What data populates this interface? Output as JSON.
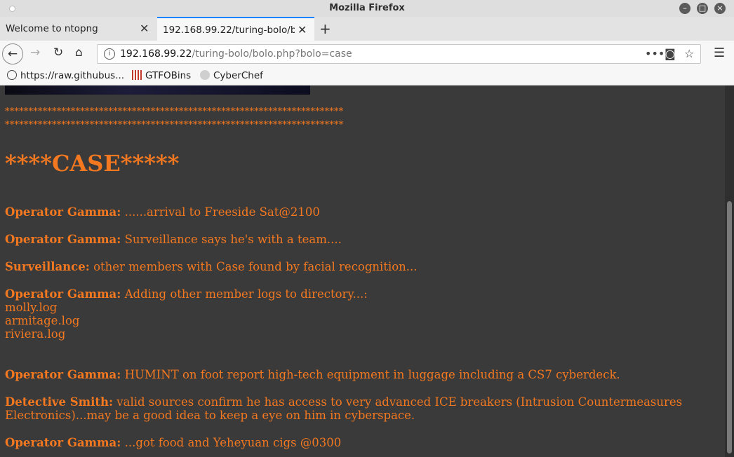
{
  "window": {
    "title": "Mozilla Firefox"
  },
  "tabs": [
    {
      "label": "Welcome to ntopng"
    },
    {
      "label": "192.168.99.22/turing-bolo/bo"
    }
  ],
  "url": {
    "host": "192.168.99.22",
    "path": "/turing-bolo/bolo.php?bolo=case"
  },
  "bookmarks": [
    {
      "label": "https://raw.githubus..."
    },
    {
      "label": "GTFOBins"
    },
    {
      "label": "CyberChef"
    }
  ],
  "page": {
    "stars_line_1": "************************************************************************",
    "stars_line_2": "************************************************************************",
    "heading": "****CASE*****",
    "entries": [
      {
        "speaker": "Operator Gamma:",
        "text": " ......arrival to Freeside Sat@2100"
      },
      {
        "speaker": "Operator Gamma:",
        "text": " Surveillance says he's with a team...."
      },
      {
        "speaker": "Surveillance:",
        "text": " other members with Case found by facial recognition..."
      },
      {
        "speaker": "Operator Gamma:",
        "text": " Adding other member logs to directory...:"
      },
      {
        "speaker": "Operator Gamma:",
        "text": " HUMINT on foot report high-tech equipment in luggage including a CS7 cyberdeck."
      },
      {
        "speaker": "Detective Smith:",
        "text": " valid sources confirm he has access to very advanced ICE breakers (Intrusion Countermeasures"
      },
      {
        "speaker": "Operator Gamma:",
        "text": " ...got food and Yeheyuan cigs @0300"
      }
    ],
    "logs": [
      "molly.log",
      "armitage.log",
      "riviera.log"
    ],
    "smith_continuation": "Electronics)...may be a good idea to keep a eye on him in cyberspace."
  }
}
